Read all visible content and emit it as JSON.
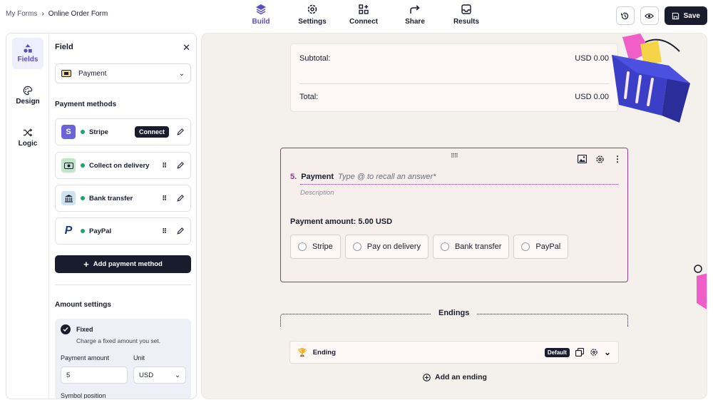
{
  "breadcrumb": {
    "root": "My Forms",
    "separator": "›",
    "current": "Online Order Form"
  },
  "nav_tabs": [
    {
      "label": "Build",
      "icon": "layers-icon",
      "active": true
    },
    {
      "label": "Settings",
      "icon": "gear-icon",
      "active": false
    },
    {
      "label": "Connect",
      "icon": "connect-icon",
      "active": false
    },
    {
      "label": "Share",
      "icon": "share-arrow-icon",
      "active": false
    },
    {
      "label": "Results",
      "icon": "inbox-icon",
      "active": false
    }
  ],
  "toolbar": {
    "save_label": "Save"
  },
  "rail": [
    {
      "label": "Fields",
      "icon": "shapes-icon",
      "active": true
    },
    {
      "label": "Design",
      "icon": "palette-icon",
      "active": false
    },
    {
      "label": "Logic",
      "icon": "shuffle-icon",
      "active": false
    }
  ],
  "field_panel": {
    "title": "Field",
    "field_type": "Payment",
    "payment_methods_title": "Payment methods",
    "methods": [
      {
        "name": "Stripe",
        "logo": "S",
        "action": "Connect"
      },
      {
        "name": "Collect on delivery",
        "logo": "cash"
      },
      {
        "name": "Bank transfer",
        "logo": "bank"
      },
      {
        "name": "PayPal",
        "logo": "P"
      }
    ],
    "add_method_label": "Add payment method",
    "amount_settings_title": "Amount settings",
    "fixed_label": "Fixed",
    "fixed_desc": "Charge a fixed amount you set.",
    "payment_amount_label": "Payment amount",
    "payment_amount_value": "5",
    "unit_label": "Unit",
    "unit_value": "USD",
    "symbol_position_label": "Symbol position"
  },
  "summary": {
    "subtotal_label": "Subtotal:",
    "subtotal_value": "USD 0.00",
    "total_label": "Total:",
    "total_value": "USD 0.00"
  },
  "question": {
    "number": "5.",
    "title": "Payment",
    "placeholder": "Type @ to recall an answer*",
    "description_placeholder": "Description",
    "amount_text": "Payment amount: 5.00 USD",
    "options": [
      "Stripe",
      "Pay on delivery",
      "Bank transfer",
      "PayPal"
    ]
  },
  "endings": {
    "title": "Endings",
    "ending_label": "Ending",
    "default_badge": "Default",
    "add_label": "Add an ending"
  },
  "colors": {
    "accent": "#5b4fc0",
    "dark": "#191c2c",
    "question_border": "#8e3d8b",
    "canvas_bg": "#f4f1ec",
    "status_green": "#22a36b"
  }
}
